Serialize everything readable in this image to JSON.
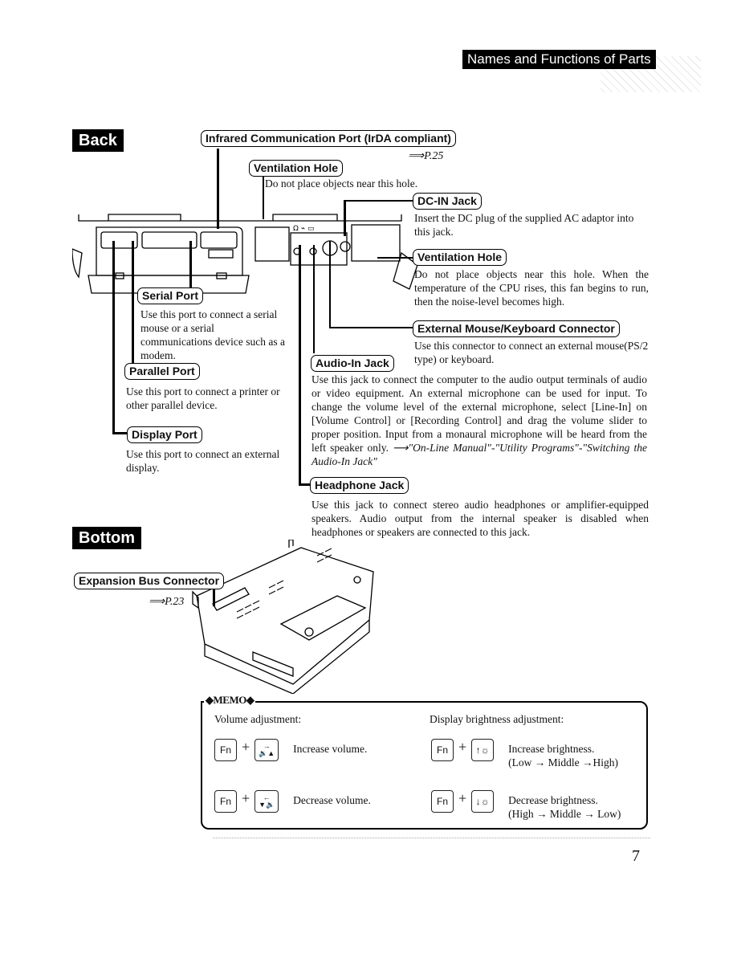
{
  "header": {
    "title": "Names and Functions of Parts"
  },
  "sections": {
    "back": {
      "label": "Back"
    },
    "bottom": {
      "label": "Bottom"
    }
  },
  "back_callouts": {
    "infrared": {
      "title": "Infrared Communication Port (IrDA compliant)",
      "ref": "⟹P.25"
    },
    "vent_hole_1": {
      "title": "Ventilation Hole",
      "desc": "Do not place objects near this hole."
    },
    "dc_in": {
      "title": "DC-IN Jack",
      "desc": "Insert the DC plug of the supplied AC adaptor into this jack."
    },
    "vent_hole_2": {
      "title": "Ventilation Hole",
      "desc": "Do not place objects near this hole. When the temperature of the CPU rises, this fan begins to run, then the noise-level becomes high."
    },
    "serial": {
      "title": "Serial Port",
      "desc": "Use this port to connect a serial mouse or a serial communications device such as a modem."
    },
    "ext_mouse": {
      "title": "External Mouse/Keyboard Connector",
      "desc": "Use this connector to connect an external mouse(PS/2 type) or keyboard."
    },
    "parallel": {
      "title": "Parallel Port",
      "desc": "Use this port to connect a printer or other parallel device."
    },
    "audio_in": {
      "title": "Audio-In Jack",
      "desc": "Use this jack to connect the computer to the audio output terminals of audio or video equipment. An external microphone can be used for input. To change the volume level of the external microphone, select [Line-In] on [Volume Control] or [Recording Control] and drag the volume slider to proper position. Input from a monaural microphone will be heard from the left speaker only.",
      "ref": "⟶\"On-Line Manual\"-\"Utility Programs\"-\"Switching the Audio-In Jack\""
    },
    "display": {
      "title": "Display Port",
      "desc": "Use this port to connect an external display."
    },
    "headphone": {
      "title": "Headphone Jack",
      "desc": "Use this jack to connect stereo audio headphones or amplifier-equipped speakers. Audio output from the internal speaker is disabled when headphones or speakers are connected to this jack."
    }
  },
  "bottom_callouts": {
    "expansion": {
      "title": "Expansion Bus Connector",
      "ref": "⟹P.23"
    }
  },
  "memo": {
    "title": "◆MEMO◆",
    "volume": {
      "heading": "Volume adjustment:",
      "rows": [
        {
          "key1": "Fn",
          "plus": "+",
          "key2_top": "→",
          "key2_bottom": "🔉▲",
          "text": "Increase volume."
        },
        {
          "key1": "Fn",
          "plus": "+",
          "key2_top": "←",
          "key2_bottom": "▼🔉",
          "text": "Decrease volume."
        }
      ]
    },
    "brightness": {
      "heading": "Display brightness adjustment:",
      "rows": [
        {
          "key1": "Fn",
          "plus": "+",
          "key2": "↑☼",
          "text": "Increase brightness.",
          "sub": "(Low → Middle →High)"
        },
        {
          "key1": "Fn",
          "plus": "+",
          "key2": "↓☼",
          "text": "Decrease brightness.",
          "sub": "(High → Middle → Low)"
        }
      ]
    }
  },
  "footer": {
    "page_number": "7"
  }
}
